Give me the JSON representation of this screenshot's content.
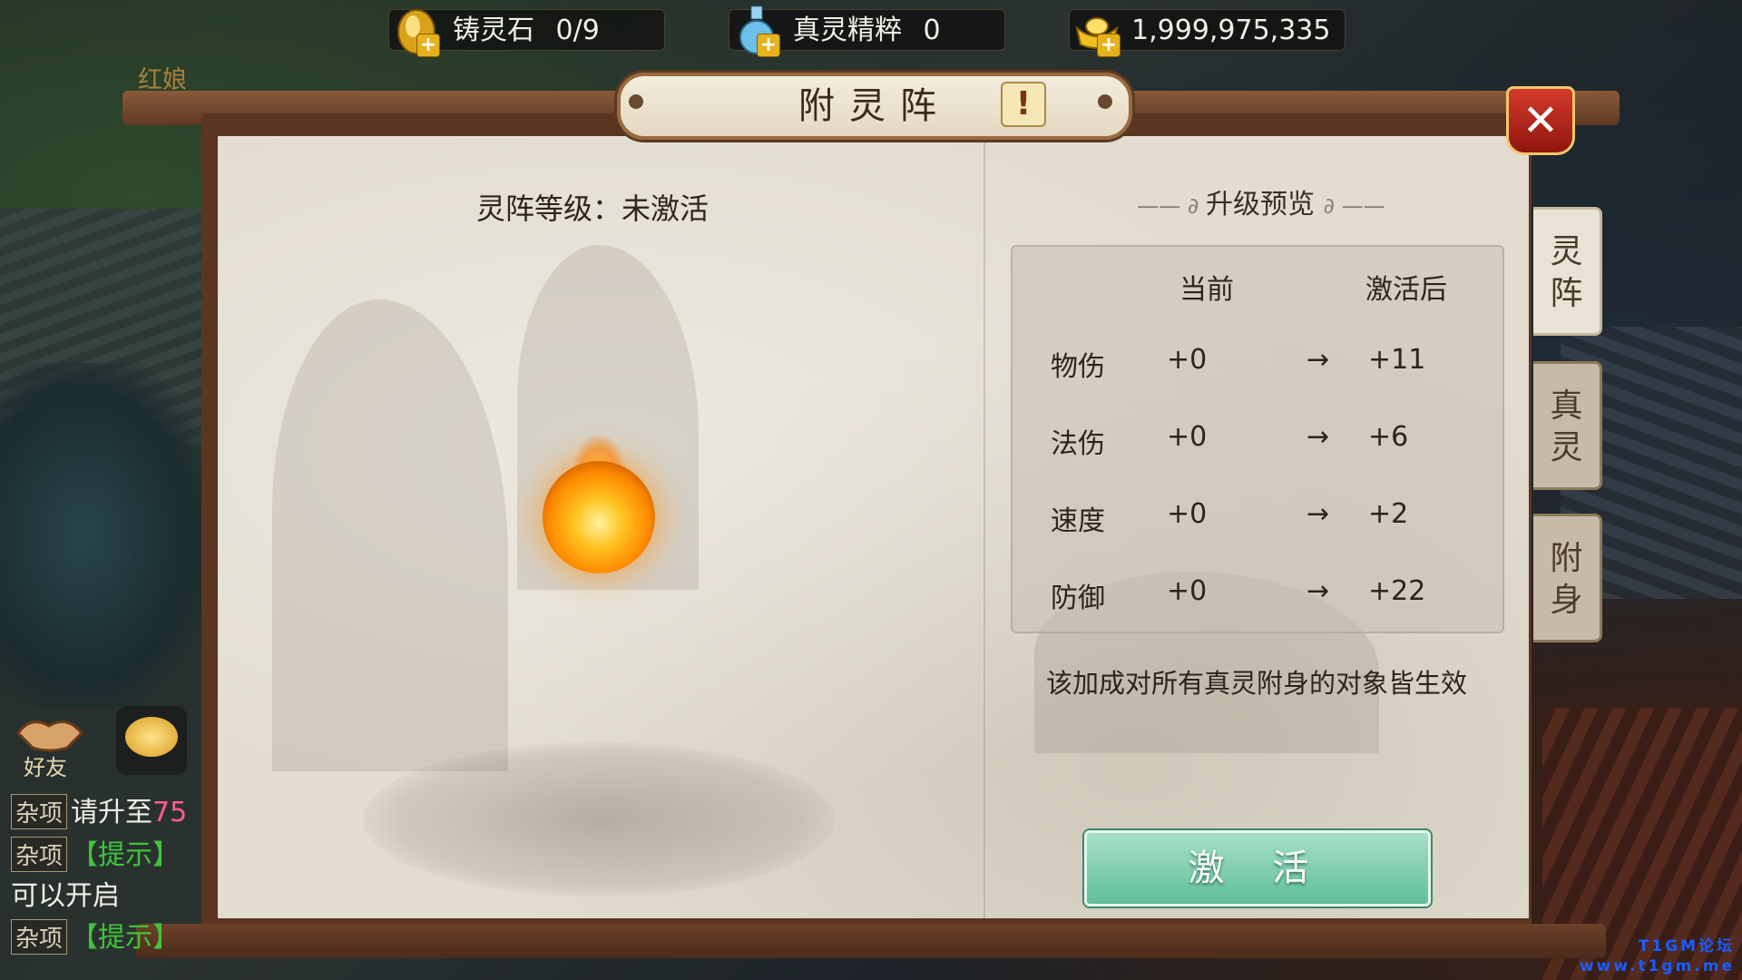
{
  "hud": {
    "npc_name": "红娘",
    "resources": [
      {
        "label": "铸灵石",
        "value": "0/9",
        "icon": "spirit-stone-icon"
      },
      {
        "label": "真灵精粹",
        "value": "0",
        "icon": "essence-bottle-icon"
      },
      {
        "label": "",
        "value": "1,999,975,335",
        "icon": "gold-ingot-icon"
      }
    ]
  },
  "dialog": {
    "title": "附灵阵",
    "info_button": "!",
    "close_button": "✕",
    "level_label": "灵阵等级：未激活",
    "preview": {
      "heading": "升级预览",
      "col_current": "当前",
      "col_after": "激活后",
      "arrow": "→",
      "rows": [
        {
          "stat": "物伤",
          "current": "+0",
          "after": "+11"
        },
        {
          "stat": "法伤",
          "current": "+0",
          "after": "+6"
        },
        {
          "stat": "速度",
          "current": "+0",
          "after": "+2"
        },
        {
          "stat": "防御",
          "current": "+0",
          "after": "+22"
        }
      ]
    },
    "note": "该加成对所有真灵附身的对象皆生效",
    "activate_button": "激 活",
    "tabs": [
      {
        "label": "灵\n阵",
        "active": true
      },
      {
        "label": "真\n灵",
        "active": false
      },
      {
        "label": "附\n身",
        "active": false
      }
    ]
  },
  "sidebar": {
    "friend_label": "好友"
  },
  "chat": [
    {
      "tag": "杂项",
      "text": "请升至",
      "extra": "75"
    },
    {
      "tag": "杂项",
      "text": "【提示】",
      "extra": ""
    },
    {
      "tag": "",
      "text": "可以开启",
      "extra": ""
    },
    {
      "tag": "杂项",
      "text": "【提示】",
      "extra": ""
    }
  ],
  "watermark": {
    "line1": "T1GM论坛",
    "line2": "www.t1gm.me"
  },
  "colors": {
    "accent_green": "#5fbf9a",
    "close_red": "#c8301f",
    "frame_brown": "#5a3521"
  }
}
